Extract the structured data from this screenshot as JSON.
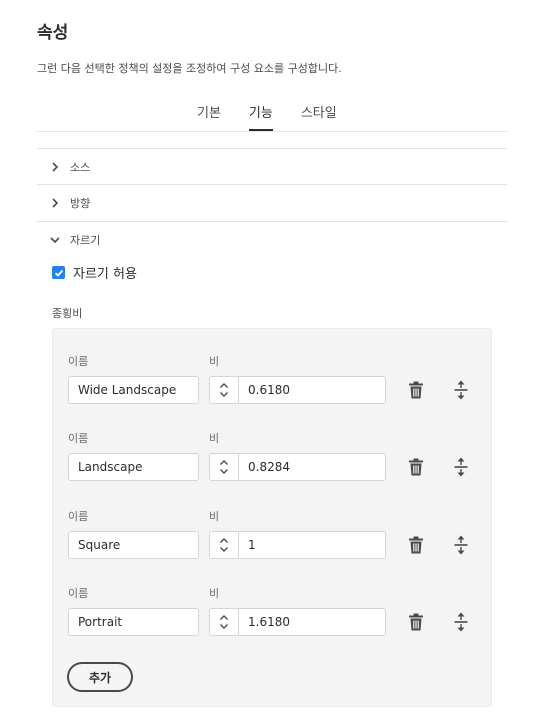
{
  "header": {
    "title": "속성",
    "subtitle": "그런 다음 선택한 정책의 설정을 조정하여 구성 요소를 구성합니다."
  },
  "tabs": [
    {
      "label": "기본",
      "active": false
    },
    {
      "label": "기능",
      "active": true
    },
    {
      "label": "스타일",
      "active": false
    }
  ],
  "accordion": [
    {
      "label": "소스",
      "expanded": false
    },
    {
      "label": "방향",
      "expanded": false
    },
    {
      "label": "자르기",
      "expanded": true
    }
  ],
  "crop": {
    "allow_label": "자르기 허용",
    "allow_checked": true,
    "ratio_section_label": "종횡비",
    "name_label": "이름",
    "ratio_label": "비",
    "rows": [
      {
        "name": "Wide Landscape",
        "ratio": "0.6180"
      },
      {
        "name": "Landscape",
        "ratio": "0.8284"
      },
      {
        "name": "Square",
        "ratio": "1"
      },
      {
        "name": "Portrait",
        "ratio": "1.6180"
      }
    ],
    "add_label": "추가"
  },
  "colors": {
    "accent": "#2680eb",
    "text": "#2c2c2c",
    "panel_bg": "#f4f4f4"
  },
  "icons": [
    "chevron-right-icon",
    "chevron-down-icon",
    "checkmark-icon",
    "chevron-up-down-icon",
    "trash-icon",
    "drag-handle-icon"
  ]
}
